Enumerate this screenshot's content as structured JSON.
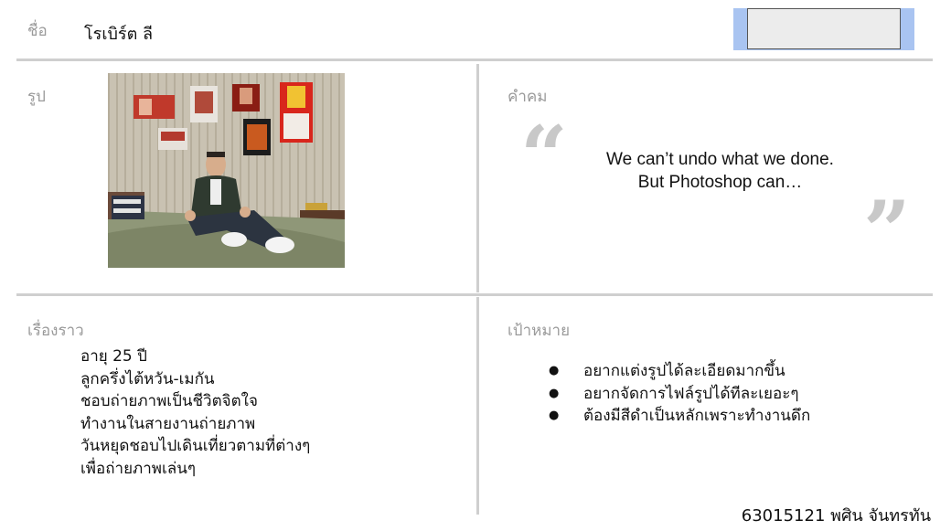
{
  "header": {
    "name_label": "ชื่อ",
    "name_value": "โรเบิร์ต ลี"
  },
  "photo_section": {
    "label": "รูป"
  },
  "quote_section": {
    "label": "คำคม",
    "open_mark": "“",
    "close_mark": "”",
    "lines": [
      "We can’t undo what we done.",
      "But Photoshop can…"
    ]
  },
  "story_section": {
    "label": "เรื่องราว",
    "lines": [
      "อายุ 25 ปี",
      "ลูกครึ่งไต้หวัน-เมกัน",
      "ชอบถ่ายภาพเป็นชีวิตจิตใจ",
      "ทำงานในสายงานถ่ายภาพ",
      "วันหยุดชอบไปเดินเที่ยวตามที่ต่างๆ",
      "เพื่อถ่ายภาพเล่นๆ"
    ]
  },
  "goals_section": {
    "label": "เป้าหมาย",
    "items": [
      "อยากแต่งรูปได้ละเอียดมากขึ้น",
      "อยากจัดการไฟล์รูปได้ทีละเยอะๆ",
      "ต้องมีสีดำเป็นหลักเพราะทำงานดึก"
    ]
  },
  "footer": {
    "credit": "63015121 พศิน จันทรทัน"
  },
  "colors": {
    "label_gray": "#9a9a9a",
    "divider": "#cfcfcf",
    "placeholder_blue": "#a9c4f1",
    "quote_mark": "#c8c8c8"
  }
}
